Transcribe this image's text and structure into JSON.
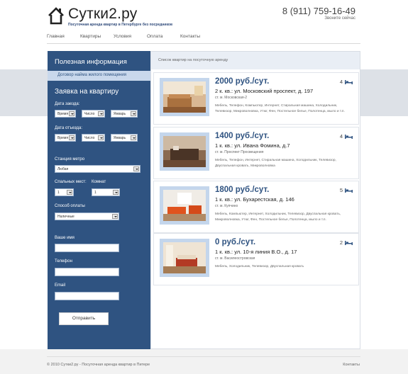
{
  "header": {
    "logo_text": "Сутки2.ру",
    "tagline": "Посуточная аренда квартир в Петербурге без посредников",
    "phone": "8 (911) 759-16-49",
    "callback": "Звоните сейчас"
  },
  "nav": {
    "items": [
      {
        "label": "Главная"
      },
      {
        "label": "Квартиры"
      },
      {
        "label": "Условия"
      },
      {
        "label": "Оплата"
      },
      {
        "label": "Контакты"
      }
    ]
  },
  "sidebar": {
    "title": "Полезная информация",
    "link": "Договор найма жилого помещения",
    "form_title": "Заявка на квартиру",
    "checkin_label": "Дата заезда:",
    "checkout_label": "Дата отъезда:",
    "checkin": {
      "time": "Время",
      "day": "Число",
      "month": "Январь"
    },
    "checkout": {
      "time": "Время",
      "day": "Число",
      "month": "Январь"
    },
    "metro_label": "Станция метро",
    "metro_value": "Любая",
    "beds_label": "Спальных мест:",
    "beds_value": "1",
    "rooms_label": "Комнат",
    "rooms_value": "1",
    "payment_label": "Способ оплаты",
    "payment_value": "Наличные",
    "name_label": "Ваше имя",
    "phone_label": "Телефон",
    "email_label": "Email",
    "submit_label": "Отправить"
  },
  "main": {
    "heading": "Список квартир на посуточную аренду",
    "listings": [
      {
        "price": "2000 руб./сут.",
        "address": "2 к. кв.: ул. Московский проспект, д. 197",
        "metro": "ст. м. Московская-2",
        "amenities": "Мебель, Телефон, Компьютер, Интернет, Стиральная машина, Холодильник, Телевизор, Микроволновка, Утюг, Фен, Постельное белье, Полотенца, мыло и т.п.",
        "beds": "4"
      },
      {
        "price": "1400 руб./сут.",
        "address": "1 к. кв.: ул. Ивана Фомина, д.7",
        "metro": "ст. м. Проспект Просвещения",
        "amenities": "Мебель, Телефон, Интернет, Стиральная машина, Холодильник, Телевизор, Двуспальная кровать, Микроволновка",
        "beds": "4"
      },
      {
        "price": "1800 руб./сут.",
        "address": "1 к. кв.: ул. Бухарестская, д. 146",
        "metro": "ст. м. Купчино",
        "amenities": "Мебель, Компьютер, Интернет, Холодильник, Телевизор, Двуспальная кровать, Микроволновка, Утюг, Фен, Постельное белье, Полотенца, мыло и т.п.",
        "beds": "5"
      },
      {
        "price": "0 руб./сут.",
        "address": "1 к. кв.: ул. 10-я линия В.О., д. 17",
        "metro": "ст. м. Василеостровская",
        "amenities": "Мебель, Холодильник, Телевизор, Двуспальная кровать",
        "beds": "2"
      }
    ]
  },
  "footer": {
    "copyright": "© 2010 Сутки2.ру - Посуточная аренда квартир в Питере",
    "contacts": "Контакты"
  },
  "colors": {
    "accent": "#2f5381",
    "sidebar_link_bg": "#c9d8ec",
    "band": "#dde1e7"
  }
}
